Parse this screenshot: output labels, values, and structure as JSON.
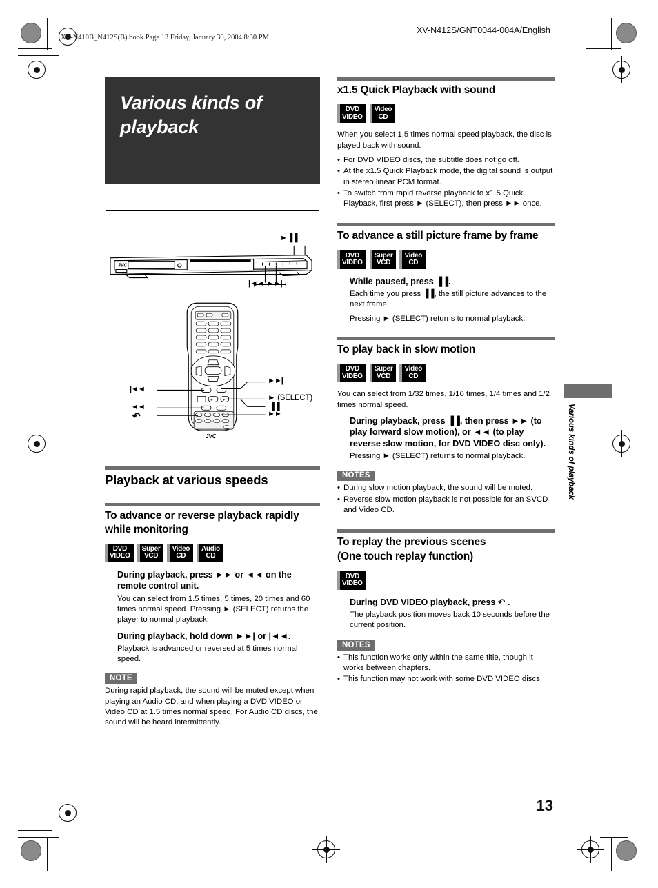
{
  "header": {
    "file_line": "XV-N410B_N412S(B).book  Page 13  Friday, January 30, 2004  8:30 PM",
    "doc_code": "XV-N412S/GNT0044-004A/English"
  },
  "chapter": {
    "title": "Various kinds of playback"
  },
  "side_tab": {
    "label": "Various kinds of playback"
  },
  "page_number": "13",
  "illustration": {
    "player_brand": "JVC",
    "remote_brand": "JVC",
    "player_callouts": {
      "play_pause": "►▐▐",
      "skip": "|◄◄  ►►|"
    },
    "remote_callouts": {
      "prev": "|◄◄",
      "next": "►►|",
      "select": "►  (SELECT)",
      "rew": "◄◄",
      "pause": "▐▐",
      "ff": "►►",
      "replay": "↶"
    }
  },
  "left_column": {
    "section_playback_speeds": {
      "heading": "Playback at various speeds",
      "subsection": {
        "heading": "To advance or reverse playback rapidly while monitoring",
        "badges": [
          {
            "line1": "DVD",
            "line2": "VIDEO"
          },
          {
            "line1": "Super",
            "line2": "VCD"
          },
          {
            "line1": "Video",
            "line2": "CD"
          },
          {
            "line1": "Audio",
            "line2": "CD"
          }
        ],
        "step1_head": "During playback, press ►► or ◄◄ on the remote control unit.",
        "step1_body": "You can select from 1.5 times, 5 times, 20 times and 60 times normal speed. Pressing ► (SELECT) returns the player to normal playback.",
        "step2_head": "During playback, hold down ►►| or |◄◄.",
        "step2_body": "Playback is advanced or reversed at 5 times normal speed.",
        "note_label": "NOTE",
        "note_body": "During rapid playback, the sound will be muted except when playing an Audio CD, and when playing a DVD VIDEO or Video CD at 1.5 times normal speed. For Audio CD discs, the sound will be heard intermittently."
      }
    }
  },
  "right_column": {
    "section_quick_playback": {
      "heading": "x1.5 Quick Playback with sound",
      "badges": [
        {
          "line1": "DVD",
          "line2": "VIDEO"
        },
        {
          "line1": "Video",
          "line2": "CD"
        }
      ],
      "intro": "When you select 1.5 times normal speed playback, the disc is played back with sound.",
      "bullets": [
        "For DVD VIDEO discs, the subtitle does not go off.",
        "At the x1.5 Quick Playback mode, the digital sound is output in stereo linear PCM format.",
        "To switch from rapid reverse playback to x1.5 Quick Playback, first press ► (SELECT), then press ►► once."
      ]
    },
    "section_frame_by_frame": {
      "heading": "To advance a still picture frame by frame",
      "badges": [
        {
          "line1": "DVD",
          "line2": "VIDEO"
        },
        {
          "line1": "Super",
          "line2": "VCD"
        },
        {
          "line1": "Video",
          "line2": "CD"
        }
      ],
      "step_head": "While paused, press ▐▐.",
      "step_body_1": "Each time you press ▐▐, the still picture advances to the next frame.",
      "step_body_2": "Pressing ► (SELECT) returns to normal playback."
    },
    "section_slow_motion": {
      "heading": "To play back in slow motion",
      "badges": [
        {
          "line1": "DVD",
          "line2": "VIDEO"
        },
        {
          "line1": "Super",
          "line2": "VCD"
        },
        {
          "line1": "Video",
          "line2": "CD"
        }
      ],
      "intro": "You can select from 1/32 times, 1/16 times, 1/4 times and 1/2 times normal speed.",
      "step_head": "During playback, press ▐▐, then press ►► (to play forward slow motion), or ◄◄ (to play reverse slow motion, for DVD VIDEO disc only).",
      "step_body": "Pressing ► (SELECT) returns to normal playback.",
      "note_label": "NOTES",
      "notes": [
        "During slow motion playback, the sound will be muted.",
        "Reverse slow motion playback is not possible for an SVCD and Video CD."
      ]
    },
    "section_one_touch_replay": {
      "heading_line1": "To replay the previous scenes",
      "heading_line2": "(One touch replay function)",
      "badges": [
        {
          "line1": "DVD",
          "line2": "VIDEO"
        }
      ],
      "step_head": "During DVD VIDEO playback, press ↶ .",
      "step_body": "The playback position moves back 10 seconds before the current position.",
      "note_label": "NOTES",
      "notes": [
        "This function works only within the same title, though it works between chapters.",
        "This function may not work with some DVD VIDEO discs."
      ]
    }
  }
}
